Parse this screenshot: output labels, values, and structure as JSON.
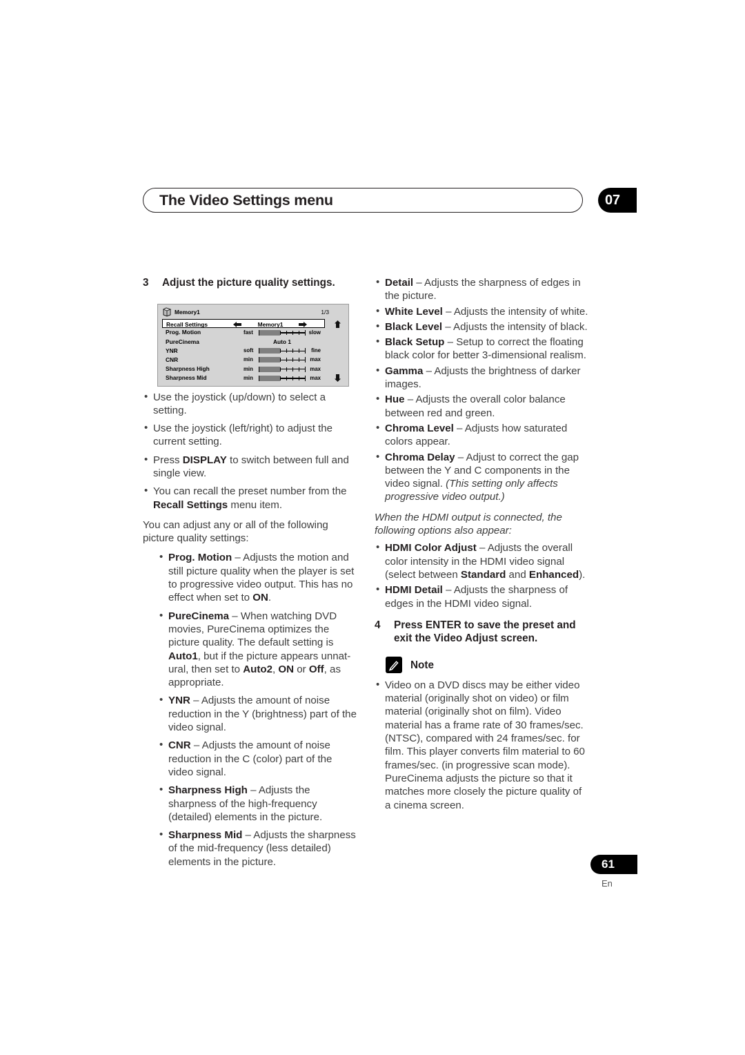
{
  "header": {
    "title": "The Video Settings menu",
    "chapter_number": "07"
  },
  "footer": {
    "page_number": "61",
    "language": "En"
  },
  "left_column": {
    "step3": {
      "number": "3",
      "text": "Adjust the picture quality settings."
    },
    "osd": {
      "memory_label": "Memory1",
      "page_indicator": "1/3",
      "rows": [
        {
          "label": "Recall Settings",
          "type": "select",
          "value": "Memory1",
          "selected": true
        },
        {
          "label": "Prog. Motion",
          "type": "slider",
          "min_label": "fast",
          "max_label": "slow",
          "fill_percent": 45
        },
        {
          "label": "PureCinema",
          "type": "value",
          "value": "Auto 1"
        },
        {
          "label": "YNR",
          "type": "slider",
          "min_label": "soft",
          "max_label": "fine",
          "fill_percent": 45
        },
        {
          "label": "CNR",
          "type": "slider",
          "min_label": "min",
          "max_label": "max",
          "fill_percent": 45
        },
        {
          "label": "Sharpness High",
          "type": "slider",
          "min_label": "min",
          "max_label": "max",
          "fill_percent": 45
        },
        {
          "label": "Sharpness Mid",
          "type": "slider",
          "min_label": "min",
          "max_label": "max",
          "fill_percent": 45
        }
      ],
      "scroll_up_icon": "arrow-up-icon",
      "scroll_down_icon": "arrow-down-icon",
      "disc_icon": "disc-memory-icon"
    },
    "bullets_usage": [
      "Use the joystick (up/down) to select a setting.",
      "Use the joystick (left/right) to adjust the current setting.",
      "Press DISPLAY to switch between full and single view.",
      "You can recall the preset number from the Recall Settings menu item."
    ],
    "intro_paragraph": "You can adjust any or all of the following picture quality settings:",
    "settings": [
      {
        "name": "Prog. Motion",
        "desc": " – Adjusts the motion and still picture quality when the player is set to progressive video output. This has no effect when set to ON."
      },
      {
        "name": "PureCinema",
        "desc": " – When watching DVD movies, PureCinema optimizes the picture quality. The default setting is Auto1, but if the picture appears unnatural, then set to Auto2, ON or Off, as appropriate."
      },
      {
        "name": "YNR",
        "desc": " – Adjusts the amount of noise reduction in the Y (brightness) part of the video signal."
      },
      {
        "name": "CNR",
        "desc": " – Adjusts the amount of noise reduction in the C (color) part of the video signal."
      },
      {
        "name": "Sharpness High",
        "desc": " – Adjusts the sharpness of the high-frequency (detailed) elements in the picture."
      },
      {
        "name": "Sharpness Mid",
        "desc": " – Adjusts the sharpness of the mid-frequency (less detailed) elements in the picture."
      }
    ]
  },
  "right_column": {
    "settings": [
      {
        "name": "Detail",
        "desc": " – Adjusts the sharpness of edges in the picture."
      },
      {
        "name": "White Level",
        "desc": " – Adjusts the intensity of white."
      },
      {
        "name": "Black Level",
        "desc": " – Adjusts the intensity of black."
      },
      {
        "name": "Black Setup",
        "desc": " – Setup to correct the floating black color for better 3-dimensional realism."
      },
      {
        "name": "Gamma",
        "desc": " – Adjusts the brightness of darker images."
      },
      {
        "name": "Hue",
        "desc": " – Adjusts the overall color balance between red and green."
      },
      {
        "name": "Chroma Level",
        "desc": " – Adjusts how saturated colors appear."
      },
      {
        "name": "Chroma Delay",
        "desc": " – Adjust to correct the gap between the Y and C components in the video signal. ",
        "italic_tail": "(This setting only affects progressive video output.)"
      }
    ],
    "hdmi_intro": "When the HDMI output is connected, the following options also appear:",
    "hdmi_settings": [
      {
        "name": "HDMI Color Adjust",
        "desc_pre": " – Adjusts the overall color intensity in the HDMI video signal (select between ",
        "bold_1": "Standard",
        "desc_mid": " and ",
        "bold_2": "Enhanced",
        "desc_post": ")."
      },
      {
        "name": "HDMI Detail",
        "desc": " – Adjusts the sharpness of edges in the HDMI video signal."
      }
    ],
    "step4": {
      "number": "4",
      "text": "Press ENTER to save the preset and exit the Video Adjust screen."
    },
    "note": {
      "label": "Note",
      "icon": "pencil-note-icon",
      "body": "Video on a DVD discs may be either video material (originally shot on video) or film material (originally shot on film). Video material has a frame rate of 30 frames/sec.(NTSC), compared with 24 frames/sec. for film. This player converts film material to 60 frames/sec. (in progressive scan mode). PureCinema adjusts the picture so that it matches more closely the picture quality of a cinema screen."
    }
  }
}
